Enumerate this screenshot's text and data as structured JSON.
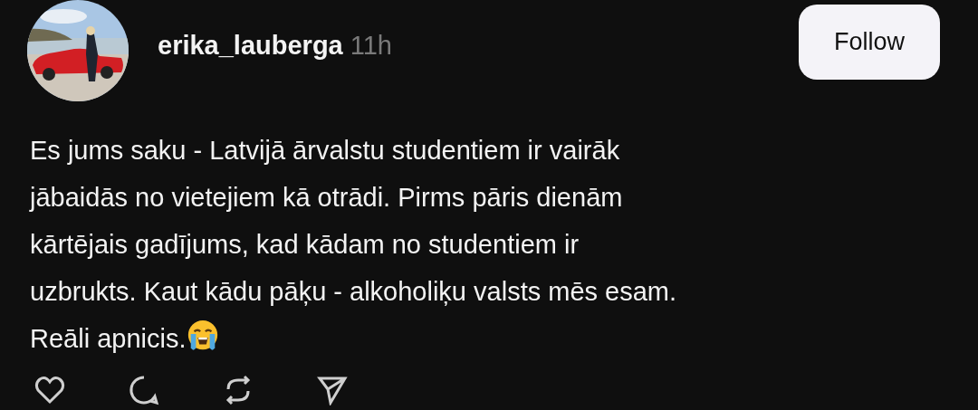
{
  "post": {
    "username": "erika_lauberga",
    "time": "11h",
    "follow_button": "Follow",
    "text_lines": [
      "Es jums saku - Latvijā ārvalstu studentiem ir vairāk",
      "jābaidās no vietejiem kā otrādi. Pirms pāris dienām",
      "kārtējais gadījums, kad kādam no studentiem ir",
      "uzbrukts. Kaut kādu pāķu - alkoholiķu valsts mēs esam.",
      "Reāli apnicis."
    ]
  },
  "actions": [
    {
      "kind": "like"
    },
    {
      "kind": "comment"
    },
    {
      "kind": "repost"
    },
    {
      "kind": "share"
    }
  ]
}
